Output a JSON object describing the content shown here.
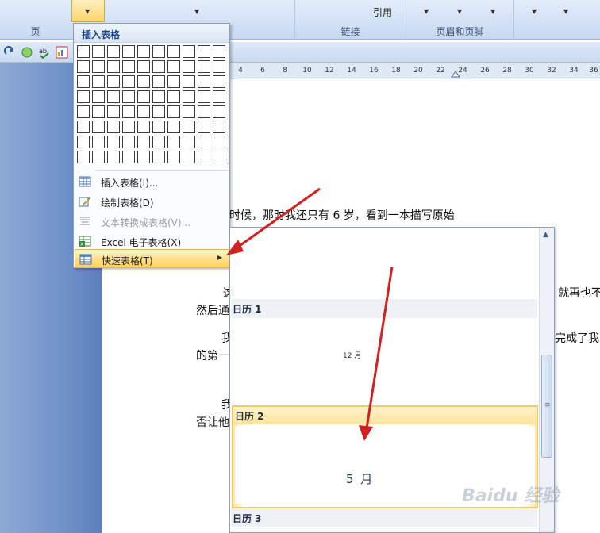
{
  "ribbon": {
    "groups": [
      {
        "label": "页"
      },
      {
        "label": "链接"
      },
      {
        "label": "页眉和页脚"
      }
    ],
    "reference_label": "引用"
  },
  "ruler": {
    "ticks": [
      "4",
      "6",
      "8",
      "10",
      "12",
      "14",
      "16",
      "18",
      "20",
      "22",
      "24",
      "26",
      "28",
      "30",
      "32",
      "34",
      "36"
    ]
  },
  "document": {
    "lines": [
      "小时候，那时我还只有 6 岁，看到一本描写原始",
      "这",
      "就再也不",
      "然后通",
      "我",
      "完成了我",
      "的第一",
      "我",
      "否让他"
    ]
  },
  "menu": {
    "header": "插入表格",
    "grid": {
      "cols": 10,
      "rows": 8
    },
    "items": [
      {
        "label": "插入表格(I)...",
        "icon": "table-icon",
        "enabled": true
      },
      {
        "label": "绘制表格(D)",
        "icon": "draw-table-icon",
        "enabled": true
      },
      {
        "label": "文本转换成表格(V)...",
        "icon": "text-to-table-icon",
        "enabled": false
      },
      {
        "label": "Excel 电子表格(X)",
        "icon": "excel-icon",
        "enabled": true
      },
      {
        "label": "快速表格(T)",
        "icon": "quick-table-icon",
        "enabled": true,
        "highlighted": true
      }
    ]
  },
  "gallery": {
    "items": [
      {
        "title": "日历 1",
        "month": "12 月"
      },
      {
        "title": "日历 2",
        "month": "5 月",
        "selected": true
      },
      {
        "title": "日历 3"
      }
    ]
  },
  "watermark": "Baidu 经验",
  "colors": {
    "arrow": "#d42020",
    "highlight": "#ffd25b",
    "ribbon": "#d2e1f5"
  }
}
